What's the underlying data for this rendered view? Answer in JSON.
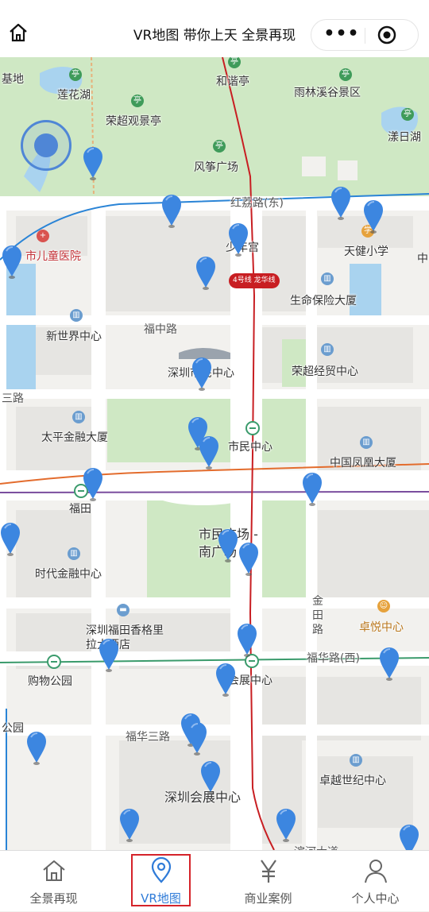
{
  "header": {
    "title": "VR地图 带你上天 全景再现",
    "menu_label": "•••"
  },
  "map": {
    "labels": [
      {
        "text": "基地"
      },
      {
        "text": "莲花湖"
      },
      {
        "text": "和谐亭"
      },
      {
        "text": "雨林溪谷景区"
      },
      {
        "text": "荣超观景亭"
      },
      {
        "text": "漾日湖"
      },
      {
        "text": "风筝广场"
      },
      {
        "text": "红荔路(东)"
      },
      {
        "text": "少年宫"
      },
      {
        "text": "天健小学"
      },
      {
        "text": "市儿童医院"
      },
      {
        "text": "中"
      },
      {
        "text": "生命保险大厦"
      },
      {
        "text": "4号线 龙华线"
      },
      {
        "text": "新世界中心"
      },
      {
        "text": "福中路"
      },
      {
        "text": "深圳市民中心"
      },
      {
        "text": "荣超经贸中心"
      },
      {
        "text": "三路"
      },
      {
        "text": "太平金融大厦"
      },
      {
        "text": "市民中心"
      },
      {
        "text": "中国凤凰大厦"
      },
      {
        "text": "福田"
      },
      {
        "text": "市民广场 -南广场"
      },
      {
        "text": "时代金融中心"
      },
      {
        "text": "金田路"
      },
      {
        "text": "卓悦中心"
      },
      {
        "text": "深圳福田香格里拉大酒店"
      },
      {
        "text": "福华路(西)"
      },
      {
        "text": "购物公园"
      },
      {
        "text": "会展中心"
      },
      {
        "text": "公园"
      },
      {
        "text": "福华三路"
      },
      {
        "text": "深圳会展中心"
      },
      {
        "text": "卓越世纪中心"
      },
      {
        "text": "滨河大道"
      }
    ],
    "pin_count": 27
  },
  "tabbar": {
    "tabs": [
      {
        "label": "全景再现",
        "icon": "home-icon"
      },
      {
        "label": "VR地图",
        "icon": "location-pin-icon",
        "active": true
      },
      {
        "label": "商业案例",
        "icon": "yen-icon"
      },
      {
        "label": "个人中心",
        "icon": "person-icon"
      }
    ]
  },
  "colors": {
    "accent": "#2f7bd8",
    "highlight_box": "#d5232a",
    "pin": "#3c86e0",
    "park": "#cfe8c4",
    "water": "#a9d3ef",
    "metro_red": "#c81e22",
    "metro_blue": "#2a84d6",
    "metro_orange": "#e36c2d",
    "metro_green": "#3b9b6c"
  }
}
